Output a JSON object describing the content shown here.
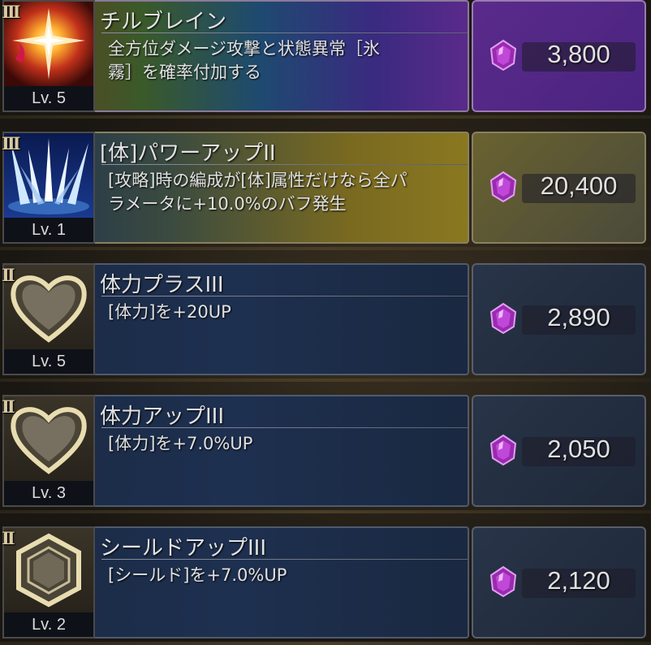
{
  "skills": [
    {
      "grade": "III",
      "icon": "burst-star-icon",
      "level": "Lv. 5",
      "title": "チルブレイン",
      "desc_line1": "全方位ダメージ攻撃と状態異常［氷",
      "desc_line2": "霧］を確率付加する",
      "currency_icon": "purple-gem-icon",
      "price": "3,800"
    },
    {
      "grade": "III",
      "icon": "ice-spikes-icon",
      "level": "Lv. 1",
      "title": "[体]パワーアップII",
      "desc_line1": "[攻略]時の編成が[体]属性だけなら全パ",
      "desc_line2": "ラメータに+10.0%のバフ発生",
      "currency_icon": "purple-gem-icon",
      "price": "20,400"
    },
    {
      "grade": "II",
      "icon": "heart-icon",
      "level": "Lv. 5",
      "title": "体力プラスIII",
      "desc_line1": "[体力]を+20UP",
      "desc_line2": "",
      "currency_icon": "purple-gem-icon",
      "price": "2,890"
    },
    {
      "grade": "II",
      "icon": "heart-icon",
      "level": "Lv. 3",
      "title": "体力アップIII",
      "desc_line1": "[体力]を+7.0%UP",
      "desc_line2": "",
      "currency_icon": "purple-gem-icon",
      "price": "2,050"
    },
    {
      "grade": "II",
      "icon": "hexagon-shield-icon",
      "level": "Lv. 2",
      "title": "シールドアップIII",
      "desc_line1": "[シールド]を+7.0%UP",
      "desc_line2": "",
      "currency_icon": "purple-gem-icon",
      "price": "2,120"
    }
  ]
}
